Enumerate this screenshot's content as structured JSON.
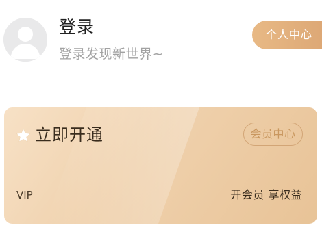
{
  "profile": {
    "login_title": "登录",
    "login_subtitle": "登录发现新世界~",
    "profile_button_label": "个人中心"
  },
  "vip_card": {
    "activate_label": "立即开通",
    "member_center_label": "会员中心",
    "vip_label": "VIP",
    "benefit_text": "开会员 享权益"
  },
  "icons": {
    "avatar": "avatar-placeholder-icon",
    "star": "star-icon"
  },
  "colors": {
    "accent": "#e0ac7a",
    "card_start": "#f7e1c6",
    "card_end": "#e8c397",
    "member_button_border": "#d2a576",
    "subtitle": "#a2a2a2"
  }
}
